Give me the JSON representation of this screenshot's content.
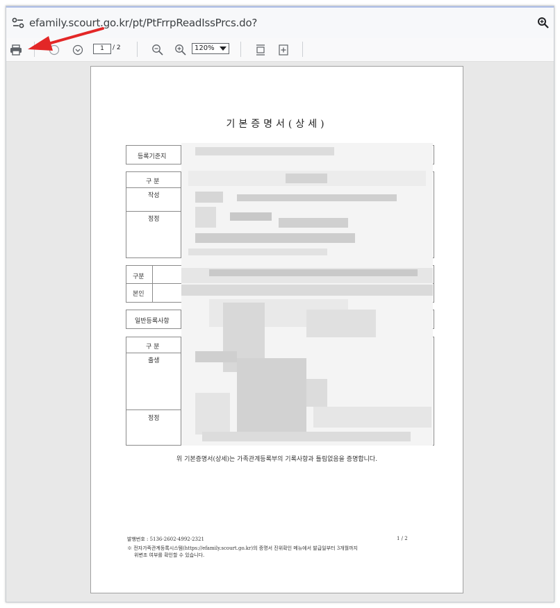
{
  "browser": {
    "url": "efamily.scourt.go.kr/pt/PtFrrpReadIssPrcs.do?"
  },
  "pdf_toolbar": {
    "current_page": "1",
    "total_pages": "/ 2",
    "zoom": "120%"
  },
  "document": {
    "title": "기본증명서(상세)",
    "labels": {
      "registration_base": "등록기준지",
      "section_header_1": "구 분",
      "written": "작성",
      "corrected_1": "정정",
      "gubun": "구분",
      "self": "본인",
      "general_items": "일반등록사항",
      "section_header_2": "구 분",
      "birth": "출생",
      "corrected_2": "정정"
    },
    "certification": "위 기본증명서(상세)는 가족관계등록부의 기록사항과 틀림없음을 증명합니다.",
    "footer": {
      "issue_number": "발행번호 : 5136-2602-4992-2321",
      "page": "1 / 2",
      "note_line1": "※ 전자가족관계등록시스템(https://efamily.scourt.go.kr)의 증명서 진위확인 메뉴에서 발급일부터 3개월까지",
      "note_line2": "위변조 여부를 확인할 수 있습니다."
    }
  },
  "annotation": {
    "arrow_color": "#e32727"
  }
}
